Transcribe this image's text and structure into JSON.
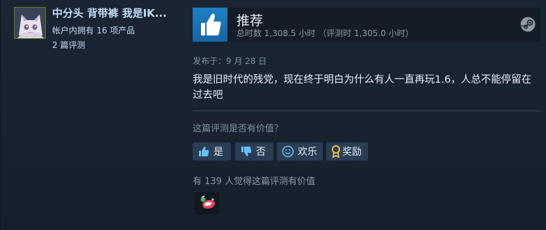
{
  "user": {
    "name": "中分头 背带裤 我是IK...",
    "products_owned": "帐户内拥有 16 项产品",
    "review_count": "2 篇评测"
  },
  "review": {
    "verdict": "推荐",
    "hours": "总时数 1,308.5 小时 （评测时 1,305.0 小时）",
    "posted": "发布于：9 月 28 日",
    "text": "我是旧时代的残党，现在终于明白为什么有人一直再玩1.6，人总不能停留在过去吧"
  },
  "helpful": {
    "question": "这篇评测是否有价值？",
    "yes_label": "是",
    "no_label": "否",
    "funny_label": "欢乐",
    "award_label": "奖励",
    "count_text": "有 139 人觉得这篇评测有价值"
  },
  "colors": {
    "recommend_blue": "#1b7ab8",
    "button_bg": "#2a3d55",
    "button_icon": "#66c0f4",
    "award_gold": "#f0c43a"
  }
}
